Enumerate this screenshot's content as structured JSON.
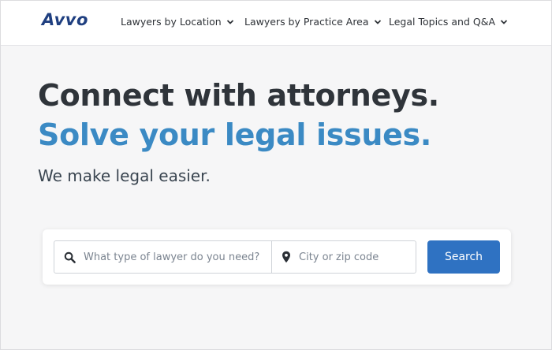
{
  "header": {
    "logo": "Avvo",
    "nav": [
      {
        "label": "Lawyers by Location"
      },
      {
        "label": "Lawyers by Practice Area"
      },
      {
        "label": "Legal Topics and Q&A"
      }
    ]
  },
  "hero": {
    "headline": "Connect with attorneys.",
    "headline_accent": "Solve your legal issues.",
    "subheadline": "We make legal easier."
  },
  "search": {
    "type_placeholder": "What type of lawyer do you need?",
    "type_value": "",
    "location_placeholder": "City or zip code",
    "location_value": "",
    "button_label": "Search"
  },
  "colors": {
    "brand": "#1f3f80",
    "accent": "#3b8ac4",
    "button": "#2f72c2"
  },
  "icons": {
    "nav": "chevron-down-icon",
    "type_field": "search-icon",
    "location_field": "map-pin-icon"
  }
}
